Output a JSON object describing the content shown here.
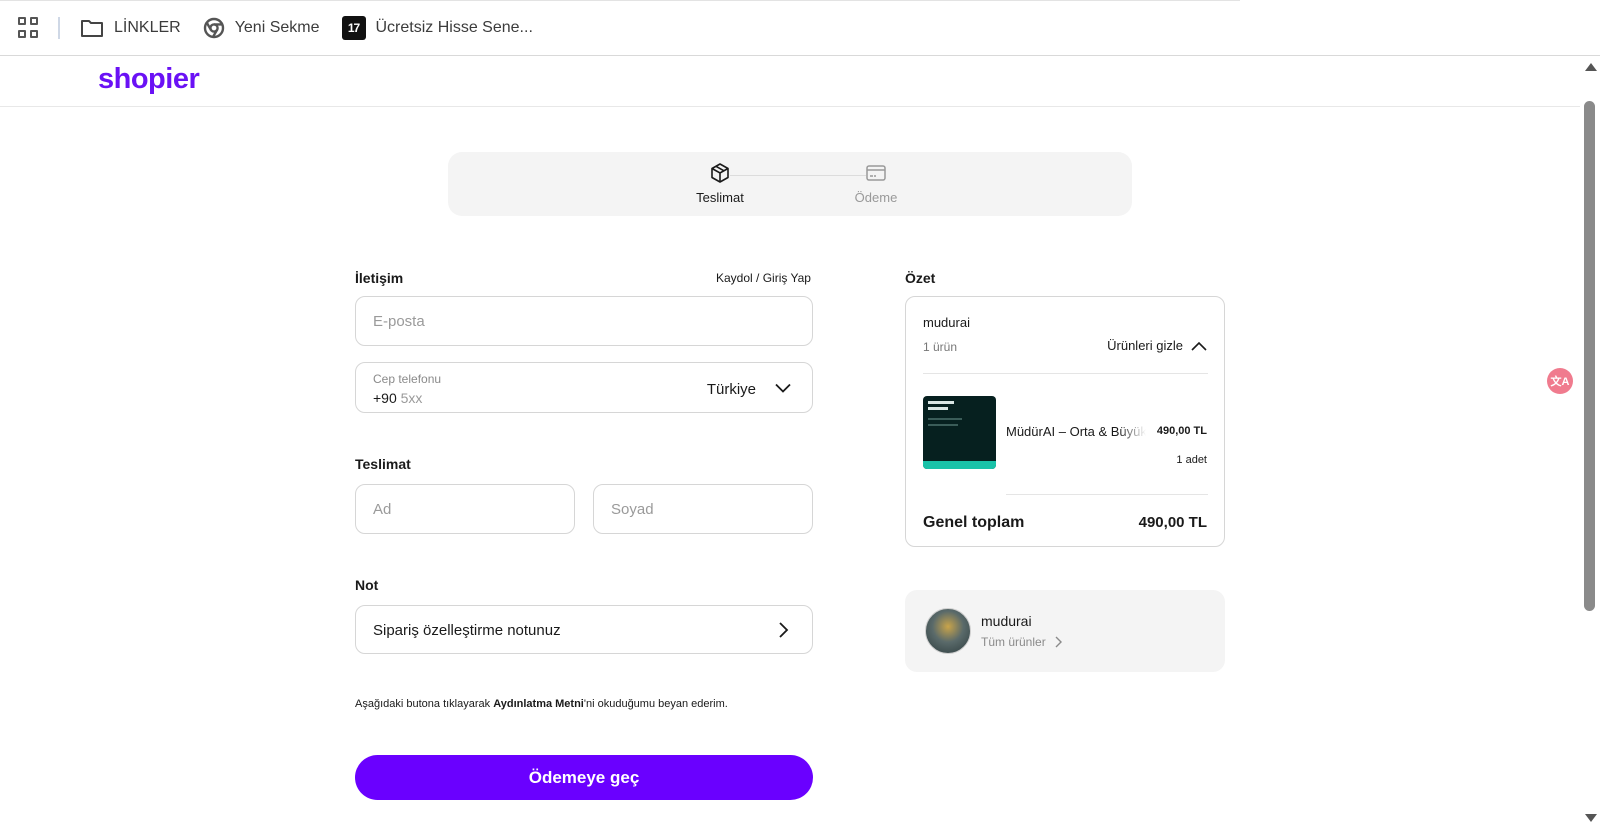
{
  "bookmarks": {
    "items": [
      {
        "label": "LİNKLER",
        "icon": "folder-icon"
      },
      {
        "label": "Yeni Sekme",
        "icon": "chrome-icon"
      },
      {
        "label": "Ücretsiz Hisse Sene...",
        "icon": "tradingview-icon"
      }
    ],
    "tradingview_glyph": "17"
  },
  "header": {
    "logo": "shopier",
    "brand_color": "#6a11f5"
  },
  "stepper": {
    "steps": [
      {
        "label": "Teslimat",
        "icon": "package-icon",
        "active": true
      },
      {
        "label": "Ödeme",
        "icon": "card-icon",
        "active": false
      }
    ]
  },
  "contact": {
    "title": "İletişim",
    "login_link": "Kaydol / Giriş Yap",
    "email_placeholder": "E-posta",
    "phone_label": "Cep telefonu",
    "phone_prefix": "+90",
    "phone_placeholder": "5xx",
    "country": "Türkiye"
  },
  "delivery": {
    "title": "Teslimat",
    "first_name_placeholder": "Ad",
    "last_name_placeholder": "Soyad"
  },
  "note": {
    "title": "Not",
    "placeholder": "Sipariş özelleştirme notunuz"
  },
  "disclaimer": {
    "before": "Aşağıdaki butona tıklayarak ",
    "link": "Aydınlatma Metni",
    "after": "'ni okuduğumu beyan ederim."
  },
  "pay_button": {
    "label": "Ödemeye geç",
    "color": "#6a00ff"
  },
  "summary": {
    "title": "Özet",
    "shop": "mudurai",
    "count": "1 ürün",
    "toggle": "Ürünleri gizle",
    "product": {
      "name": "MüdürAI – Orta & Büyük",
      "price": "490,00 TL",
      "qty": "1 adet"
    },
    "total_label": "Genel toplam",
    "total_value": "490,00 TL"
  },
  "shop_card": {
    "name": "mudurai",
    "all_products": "Tüm ürünler"
  },
  "floating": {
    "icon": "translate-icon",
    "glyph": "文A"
  }
}
